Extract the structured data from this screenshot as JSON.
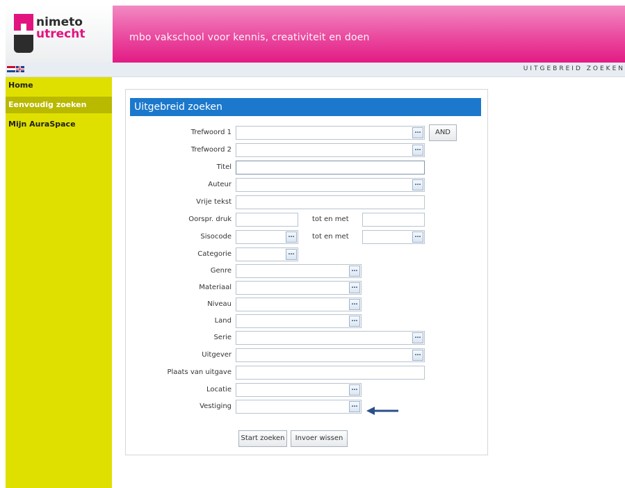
{
  "header": {
    "logo_line1": "nimeto",
    "logo_line2": "utrecht",
    "tagline": "mbo vakschool voor kennis, creativiteit en doen",
    "brand_color": "#e2137f"
  },
  "subbar": {
    "page_label": "UITGEBREID ZOEKEN"
  },
  "sidebar": {
    "items": [
      {
        "label": "Home"
      },
      {
        "label": "Eenvoudig zoeken"
      },
      {
        "label": "Mijn AuraSpace"
      }
    ],
    "color": "#dfe000"
  },
  "form": {
    "title": "Uitgebreid zoeken",
    "fields": {
      "trefwoord1": "Trefwoord 1",
      "trefwoord2": "Trefwoord 2",
      "titel": "Titel",
      "auteur": "Auteur",
      "vrije_tekst": "Vrije tekst",
      "oorspr_druk": "Oorspr. druk",
      "sisocode": "Sisocode",
      "categorie": "Categorie",
      "genre": "Genre",
      "materiaal": "Materiaal",
      "niveau": "Niveau",
      "land": "Land",
      "serie": "Serie",
      "uitgever": "Uitgever",
      "plaats": "Plaats van uitgave",
      "locatie": "Locatie",
      "vestiging": "Vestiging"
    },
    "tot_en_met": "tot en met",
    "and_button": "AND",
    "dots": "…",
    "start_button": "Start zoeken",
    "clear_button": "Invoer wissen",
    "accent": "#1b78cc"
  }
}
